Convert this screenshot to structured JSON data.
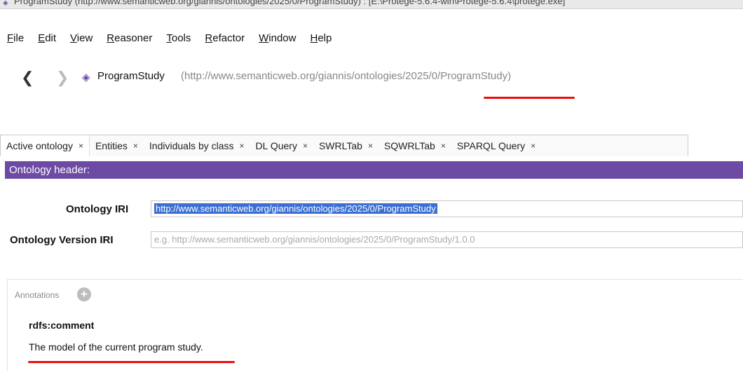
{
  "window": {
    "title": "ProgramStudy (http://www.semanticweb.org/giannis/ontologies/2025/0/ProgramStudy) : [E:\\Protege-5.6.4-win\\Protege-5.6.4\\protege.exe]"
  },
  "menu": {
    "items": [
      {
        "first": "F",
        "rest": "ile"
      },
      {
        "first": "E",
        "rest": "dit"
      },
      {
        "first": "V",
        "rest": "iew"
      },
      {
        "first": "R",
        "rest": "easoner"
      },
      {
        "first": "T",
        "rest": "ools"
      },
      {
        "first": "R",
        "rest": "efactor"
      },
      {
        "first": "W",
        "rest": "indow"
      },
      {
        "first": "H",
        "rest": "elp"
      }
    ]
  },
  "nav": {
    "back_glyph": "❮",
    "forward_glyph": "❯",
    "ontology_icon": "◈",
    "ontology_name": "ProgramStudy",
    "ontology_iri": "(http://www.semanticweb.org/giannis/ontologies/2025/0/ProgramStudy)"
  },
  "tabs": [
    {
      "label": "Active ontology"
    },
    {
      "label": "Entities"
    },
    {
      "label": "Individuals by class"
    },
    {
      "label": "DL Query"
    },
    {
      "label": "SWRLTab"
    },
    {
      "label": "SQWRLTab"
    },
    {
      "label": "SPARQL Query"
    }
  ],
  "tab_close_glyph": "×",
  "header": {
    "title": "Ontology header:"
  },
  "fields": {
    "ontology_iri_label": "Ontology IRI",
    "ontology_iri_value": "http://www.semanticweb.org/giannis/ontologies/2025/0/ProgramStudy",
    "version_iri_label": "Ontology Version IRI",
    "version_iri_placeholder": "e.g. http://www.semanticweb.org/giannis/ontologies/2025/0/ProgramStudy/1.0.0"
  },
  "annotations": {
    "header": "Annotations",
    "add_glyph": "+",
    "items": [
      {
        "property": "rdfs:comment",
        "value": "The model of the current program study."
      }
    ]
  },
  "colors": {
    "header_bar": "#6d4aa3",
    "selection": "#3a6fd1",
    "highlight_underline": "#e8100e"
  }
}
